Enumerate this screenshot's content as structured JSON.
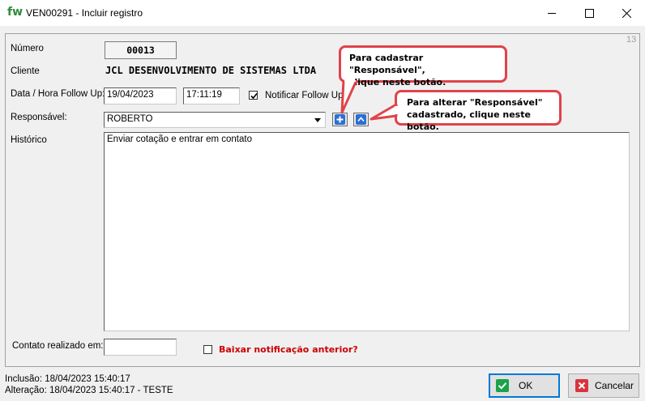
{
  "window": {
    "app_logo": "fw",
    "title": "VEN00291 - Incluir registro"
  },
  "form": {
    "corner_number": "13",
    "numero_label": "Número",
    "numero_value": "00013",
    "cliente_label": "Cliente",
    "cliente_value": "JCL DESENVOLVIMENTO DE SISTEMAS LTDA",
    "data_hora_label": "Data / Hora Follow Up:",
    "data_value": "19/04/2023",
    "hora_value": "17:11:19",
    "notificar_label": "Notificar Follow Up",
    "notificar_checked": true,
    "responsavel_label": "Responsável:",
    "responsavel_value": "ROBERTO",
    "historico_label": "Histórico",
    "historico_value": "Enviar cotação e entrar em contato",
    "contato_label": "Contato realizado em:",
    "contato_value": "",
    "baixar_label": "Baixar notificação anterior?",
    "baixar_checked": false
  },
  "callouts": {
    "cadastrar_line1": "Para cadastrar \"Responsável\",",
    "cadastrar_line2": "clique neste botão.",
    "alterar_line1": "Para alterar \"Responsável\"",
    "alterar_line2": "cadastrado, clique neste botão."
  },
  "footer": {
    "inclusao": "Inclusão: 18/04/2023 15:40:17",
    "alteracao": "Alteração: 18/04/2023 15:40:17 - TESTE",
    "ok_label": "OK",
    "cancel_label": "Cancelar"
  },
  "colors": {
    "callout_border": "#e0434a",
    "warning_text": "#cc0000",
    "ok_icon": "#1aa34a",
    "cancel_icon": "#d9333f",
    "small_button_icon": "#2b6fd6"
  },
  "icons": {
    "add": "plus-icon",
    "edit": "triangle-up-icon",
    "dropdown": "chevron-down-icon",
    "ok": "checkmark-icon",
    "cancel": "close-icon"
  }
}
